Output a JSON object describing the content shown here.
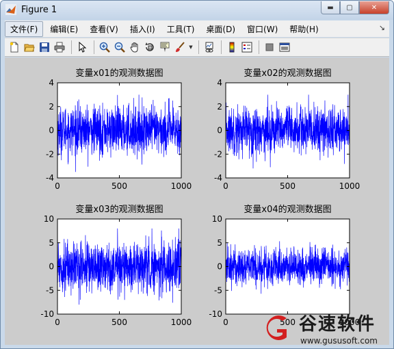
{
  "window": {
    "title": "Figure 1",
    "minimize_label": "▬",
    "maximize_label": "▢",
    "close_label": "✕"
  },
  "menubar": {
    "items": [
      {
        "label": "文件(F)"
      },
      {
        "label": "编辑(E)"
      },
      {
        "label": "查看(V)"
      },
      {
        "label": "插入(I)"
      },
      {
        "label": "工具(T)"
      },
      {
        "label": "桌面(D)"
      },
      {
        "label": "窗口(W)"
      },
      {
        "label": "帮助(H)"
      }
    ],
    "overflow_arrow": "↘"
  },
  "toolbar": {
    "icons": [
      "new-figure-icon",
      "open-file-icon",
      "save-icon",
      "print-icon",
      "edit-plot-icon",
      "zoom-in-icon",
      "zoom-out-icon",
      "pan-icon",
      "rotate-3d-icon",
      "data-cursor-icon",
      "brush-icon",
      "link-plot-icon",
      "insert-colorbar-icon",
      "insert-legend-icon",
      "hide-plot-tools-icon",
      "show-plot-tools-icon"
    ]
  },
  "watermark": {
    "name": "谷速软件",
    "url": "www.gususoft.com"
  },
  "chart_data": [
    {
      "type": "line",
      "title": "变量x01的观测数据图",
      "xlim": [
        0,
        1000
      ],
      "ylim": [
        -4,
        4
      ],
      "xticks": [
        0,
        500,
        1000
      ],
      "yticks": [
        -4,
        -2,
        0,
        2,
        4
      ],
      "n_points": 1000,
      "series": [
        {
          "color": "#0000ff",
          "mean": 0,
          "spread": 1,
          "range": [
            -4,
            3
          ]
        }
      ]
    },
    {
      "type": "line",
      "title": "变量x02的观测数据图",
      "xlim": [
        0,
        1000
      ],
      "ylim": [
        -4,
        4
      ],
      "xticks": [
        0,
        500,
        1000
      ],
      "yticks": [
        -4,
        -2,
        0,
        2,
        4
      ],
      "n_points": 1000,
      "series": [
        {
          "color": "#0000ff",
          "mean": 0,
          "spread": 1,
          "range": [
            -3.2,
            3
          ]
        }
      ]
    },
    {
      "type": "line",
      "title": "变量x03的观测数据图",
      "xlim": [
        0,
        1000
      ],
      "ylim": [
        -10,
        10
      ],
      "xticks": [
        0,
        500,
        1000
      ],
      "yticks": [
        -10,
        -5,
        0,
        5,
        10
      ],
      "n_points": 1000,
      "series": [
        {
          "color": "#0000ff",
          "mean": 0,
          "spread": 2.6,
          "range": [
            -8,
            8
          ]
        }
      ]
    },
    {
      "type": "line",
      "title": "变量x04的观测数据图",
      "xlim": [
        0,
        1000
      ],
      "ylim": [
        -10,
        10
      ],
      "xticks": [
        0,
        500,
        1000
      ],
      "yticks": [
        -10,
        -5,
        0,
        5,
        10
      ],
      "n_points": 1000,
      "series": [
        {
          "color": "#0000ff",
          "mean": 0,
          "spread": 2,
          "range": [
            -6,
            6
          ]
        }
      ]
    }
  ]
}
